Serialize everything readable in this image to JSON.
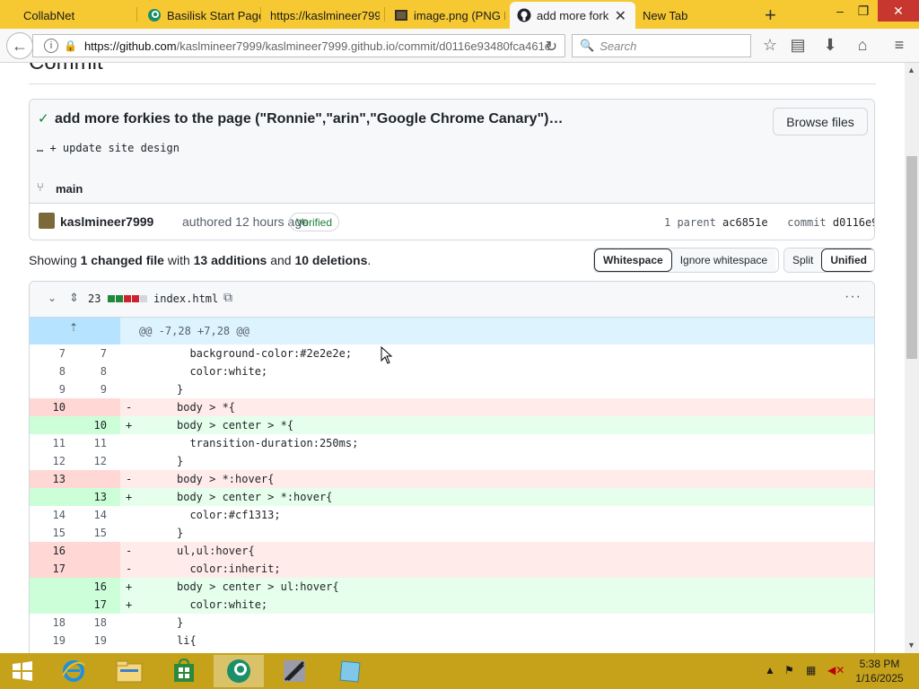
{
  "browser": {
    "tabs": [
      {
        "title": "CollabNet"
      },
      {
        "title": "Basilisk Start Page"
      },
      {
        "title": "https://kaslmineer799"
      },
      {
        "title": "image.png (PNG I"
      },
      {
        "title": "add more fork"
      },
      {
        "title": "New Tab"
      }
    ],
    "url_host": "https://github.com",
    "url_path": "/kaslmineer7999/kaslmineer7999.github.io/commit/d0116e93480fca461e",
    "search_placeholder": "Search"
  },
  "commit": {
    "heading": "Commit",
    "title": "add more forkies to the page (\"Ronnie\",\"arin\",\"Google Chrome Canary\")…",
    "description": "… + update site design",
    "browse_files_label": "Browse files",
    "branch": "main",
    "author": "kaslmineer7999",
    "authored_text": "authored 12 hours ago",
    "verified_label": "Verified",
    "parent_label": "1 parent",
    "parent_hash": "ac6851e",
    "commit_label": "commit",
    "commit_hash": "d0116e9"
  },
  "summary": {
    "showing": "Showing",
    "files_changed": "1 changed file",
    "with": "with",
    "additions": "13 additions",
    "and": "and",
    "deletions": "10 deletions",
    "period": "."
  },
  "diff_options": {
    "whitespace": "Whitespace",
    "ignore_whitespace": "Ignore whitespace",
    "split": "Split",
    "unified": "Unified"
  },
  "file": {
    "change_count": "23",
    "name": "index.html",
    "hunk_header": "@@ -7,28 +7,28 @@",
    "lines": [
      {
        "type": "ctx",
        "old": "7",
        "new": "7",
        "code": "  background-color:#2e2e2e;"
      },
      {
        "type": "ctx",
        "old": "8",
        "new": "8",
        "code": "  color:white;"
      },
      {
        "type": "ctx",
        "old": "9",
        "new": "9",
        "code": "}"
      },
      {
        "type": "del",
        "old": "10",
        "new": "",
        "code": "body > *{"
      },
      {
        "type": "add",
        "old": "",
        "new": "10",
        "code": "body > center > *{"
      },
      {
        "type": "ctx",
        "old": "11",
        "new": "11",
        "code": "  transition-duration:250ms;"
      },
      {
        "type": "ctx",
        "old": "12",
        "new": "12",
        "code": "}"
      },
      {
        "type": "del",
        "old": "13",
        "new": "",
        "code": "body > *:hover{"
      },
      {
        "type": "add",
        "old": "",
        "new": "13",
        "code": "body > center > *:hover{"
      },
      {
        "type": "ctx",
        "old": "14",
        "new": "14",
        "code": "  color:#cf1313;"
      },
      {
        "type": "ctx",
        "old": "15",
        "new": "15",
        "code": "}"
      },
      {
        "type": "del",
        "old": "16",
        "new": "",
        "code": "ul,ul:hover{"
      },
      {
        "type": "del",
        "old": "17",
        "new": "",
        "code": "  color:inherit;"
      },
      {
        "type": "add",
        "old": "",
        "new": "16",
        "code": "body > center > ul:hover{"
      },
      {
        "type": "add",
        "old": "",
        "new": "17",
        "code": "  color:white;"
      },
      {
        "type": "ctx",
        "old": "18",
        "new": "18",
        "code": "}"
      },
      {
        "type": "ctx",
        "old": "19",
        "new": "19",
        "code": "li{"
      }
    ]
  },
  "taskbar": {
    "time": "5:38 PM",
    "date": "1/16/2025"
  },
  "colors": {
    "tabbar": "#f6c933",
    "taskbar": "#c6a21a",
    "added_bg": "#e6ffec",
    "deleted_bg": "#ffebe9",
    "hunk_bg": "#ddf4ff",
    "verified": "#1a7f37"
  },
  "icons": [
    "back-arrow-icon",
    "info-icon",
    "lock-icon",
    "reload-icon",
    "search-icon",
    "star-icon",
    "reading-list-icon",
    "download-icon",
    "home-icon",
    "menu-icon",
    "check-icon",
    "branch-icon",
    "copy-icon",
    "more-icon",
    "chevron-down-icon",
    "expand-icon",
    "start-icon",
    "ie-icon",
    "explorer-icon",
    "store-icon"
  ]
}
